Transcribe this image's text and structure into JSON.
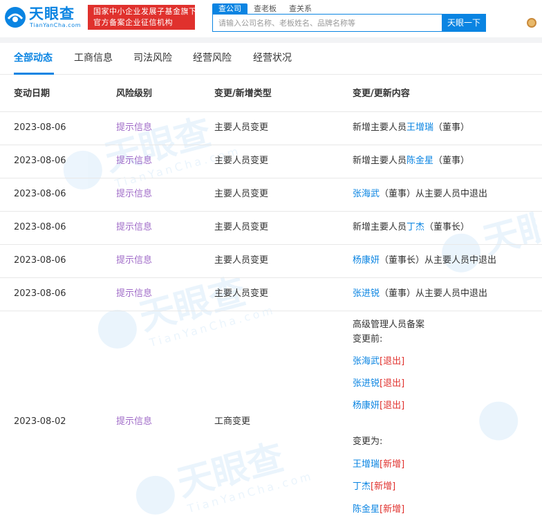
{
  "header": {
    "logo_text": "天眼查",
    "logo_sub": "TianYanCha.com",
    "banner_line1": "国家中小企业发展子基金旗下",
    "banner_line2": "官方备案企业征信机构",
    "search_tabs": [
      "查公司",
      "查老板",
      "查关系"
    ],
    "search_placeholder": "请输入公司名称、老板姓名、品牌名称等",
    "search_button": "天眼一下"
  },
  "tabs": [
    "全部动态",
    "工商信息",
    "司法风险",
    "经营风险",
    "经营状况"
  ],
  "table": {
    "headers": [
      "变动日期",
      "风险级别",
      "变更/新增类型",
      "变更/更新内容"
    ],
    "rows": [
      {
        "date": "2023-08-06",
        "level": "提示信息",
        "type": "主要人员变更",
        "pre": "新增主要人员",
        "name": "王增瑞",
        "post": "（董事）"
      },
      {
        "date": "2023-08-06",
        "level": "提示信息",
        "type": "主要人员变更",
        "pre": "新增主要人员",
        "name": "陈金星",
        "post": "（董事）"
      },
      {
        "date": "2023-08-06",
        "level": "提示信息",
        "type": "主要人员变更",
        "pre": "",
        "name": "张海武",
        "post": "（董事）从主要人员中退出"
      },
      {
        "date": "2023-08-06",
        "level": "提示信息",
        "type": "主要人员变更",
        "pre": "新增主要人员",
        "name": "丁杰",
        "post": "（董事长）"
      },
      {
        "date": "2023-08-06",
        "level": "提示信息",
        "type": "主要人员变更",
        "pre": "",
        "name": "杨康妍",
        "post": "（董事长）从主要人员中退出"
      },
      {
        "date": "2023-08-06",
        "level": "提示信息",
        "type": "主要人员变更",
        "pre": "",
        "name": "张进锐",
        "post": "（董事）从主要人员中退出"
      }
    ],
    "big_row": {
      "date": "2023-08-02",
      "level": "提示信息",
      "type": "工商变更",
      "title": "高级管理人员备案",
      "before_label": "变更前:",
      "before": [
        {
          "name": "张海武",
          "tag": "[退出]"
        },
        {
          "name": "张进锐",
          "tag": "[退出]"
        },
        {
          "name": "杨康妍",
          "tag": "[退出]"
        }
      ],
      "after_label": "变更为:",
      "after": [
        {
          "name": "王增瑞",
          "tag": "[新增]"
        },
        {
          "name": "丁杰",
          "tag": "[新增]"
        },
        {
          "name": "陈金星",
          "tag": "[新增]"
        }
      ]
    }
  },
  "watermark": {
    "text": "天眼查",
    "sub": "TianYanCha.com"
  },
  "colors": {
    "accent": "#0a84e2",
    "banner": "#e0312d",
    "tag": "#a06bc8"
  }
}
